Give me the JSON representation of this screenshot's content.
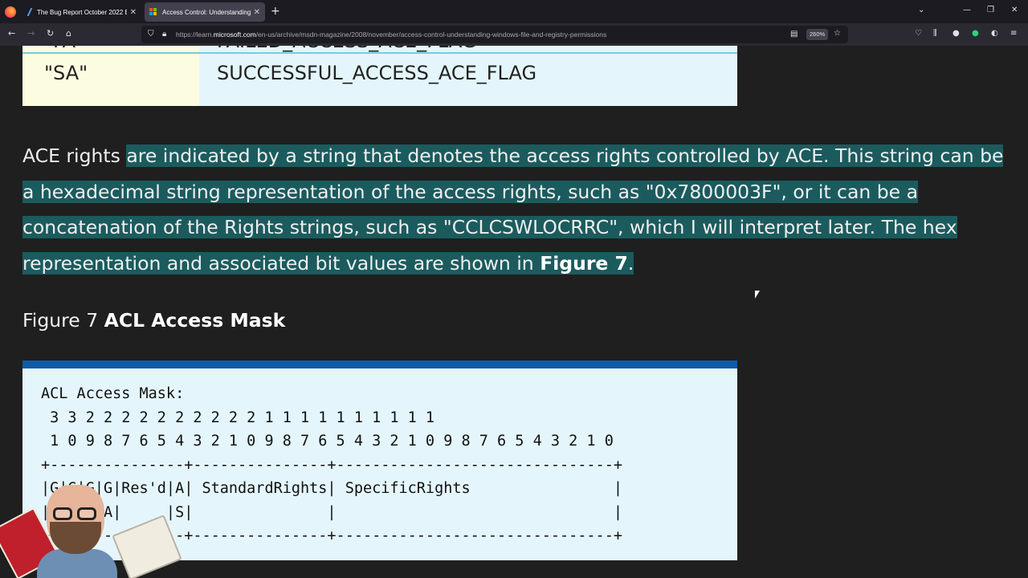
{
  "browser": {
    "tabs": [
      {
        "title": "The Bug Report October 2022 E",
        "icon": "pen-icon",
        "active": false
      },
      {
        "title": "Access Control: Understanding",
        "icon": "microsoft-logo-icon",
        "active": true
      }
    ],
    "new_tab": "+",
    "window_controls": {
      "minimize": "—",
      "restore": "❐",
      "close": "✕",
      "list_tabs": "⌄"
    },
    "url": {
      "prefix": "https://learn.",
      "domain": "microsoft.com",
      "path": "/en-us/archive/msdn-magazine/2008/november/access-control-understanding-windows-file-and-registry-permissions"
    },
    "zoom": "260%"
  },
  "article": {
    "flag_table": {
      "row_cut": [
        "\"FA\"",
        "FAILED_ACCESS_ACE_FLAG"
      ],
      "row": [
        "\"SA\"",
        "SUCCESSFUL_ACCESS_ACE_FLAG"
      ]
    },
    "paragraph": {
      "lead": "ACE rights ",
      "highlighted": "are indicated by a string that denotes the access rights controlled by ACE. This string can be a hexadecimal string representation of the access rights, such as \"0x7800003F\", or it can be a concatenation of the Rights strings, such as \"CCLCSWLOCRRC\", which I will interpret later. The hex representation and associated bit values are shown in ",
      "figure_ref": "Figure 7",
      "end": "."
    },
    "figure": {
      "label": "Figure 7 ",
      "title": "ACL Access Mask",
      "code": "ACL Access Mask:\n 3 3 2 2 2 2 2 2 2 2 2 2 1 1 1 1 1 1 1 1 1 1\n 1 0 9 8 7 6 5 4 3 2 1 0 9 8 7 6 5 4 3 2 1 0 9 8 7 6 5 4 3 2 1 0\n+---------------+---------------+-------------------------------+\n|G|G|G|G|Res'd|A| StandardRights| SpecificRights                |\n|R|W|E|A|     |S|               |                               |\n+-+-------------+---------------+-------------------------------+"
    }
  },
  "colors": {
    "highlight": "#1b5b5e",
    "page_bg": "#1f1f1f",
    "code_bg": "#e4f6fc",
    "code_header": "#0e5aa7"
  }
}
